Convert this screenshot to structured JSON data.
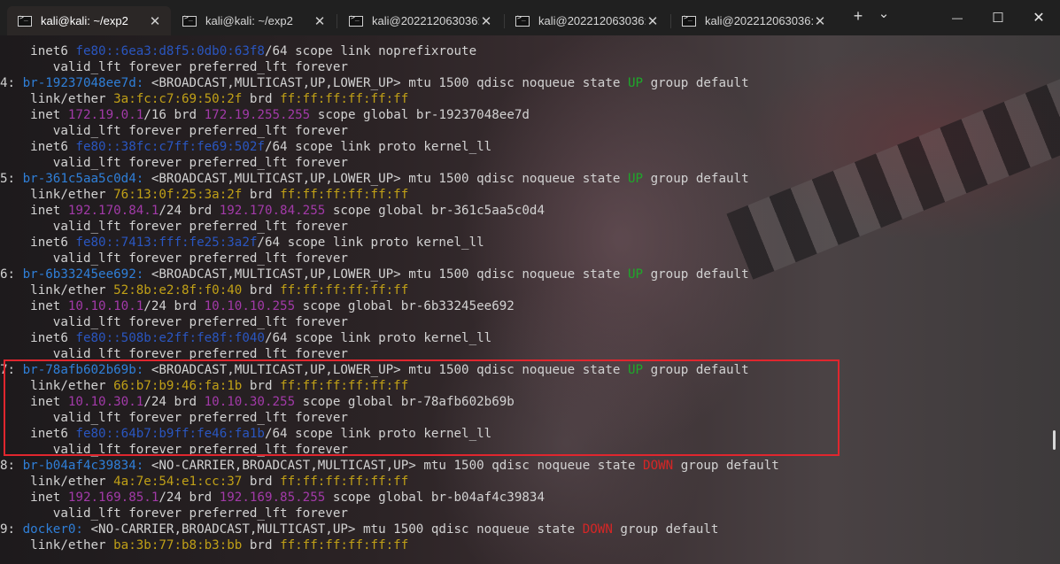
{
  "tabs": [
    {
      "title": "kali@kali: ~/exp2",
      "active": true,
      "icon": "terminal-icon",
      "close": "✕"
    },
    {
      "title": "kali@kali: ~/exp2",
      "active": false,
      "icon": "terminal-icon",
      "close": "✕"
    },
    {
      "title": "kali@202212063036:",
      "active": false,
      "icon": "terminal-icon",
      "close": "✕"
    },
    {
      "title": "kali@202212063036:",
      "active": false,
      "icon": "terminal-icon",
      "close": "✕"
    },
    {
      "title": "kali@202212063036:",
      "active": false,
      "icon": "cmd-icon",
      "close": "✕"
    }
  ],
  "toolbar": {
    "new_tab": "+",
    "dropdown": "⌄"
  },
  "window_controls": {
    "minimize": "—",
    "maximize": "☐",
    "close": "✕"
  },
  "colors": {
    "interface_name": "#2f7fd8",
    "ipv6": "#2a56c0",
    "ipv4": "#a23aa8",
    "mac": "#c0a017",
    "state_up": "#1ea82a",
    "state_down": "#d62626",
    "highlight_box": "#e0262e"
  },
  "terminal_lines": [
    [
      {
        "t": "    inet6 ",
        "c": "w"
      },
      {
        "t": "fe80::6ea3:d8f5:0db0:63f8",
        "c": "ipv6"
      },
      {
        "t": "/64 scope link noprefixroute",
        "c": "w"
      }
    ],
    [
      {
        "t": "       valid_lft forever preferred_lft forever",
        "c": "w"
      }
    ],
    [
      {
        "t": "4: ",
        "c": "w"
      },
      {
        "t": "br-19237048ee7d:",
        "c": "blue"
      },
      {
        "t": " <BROADCAST,MULTICAST,UP,LOWER_UP> mtu 1500 qdisc noqueue state ",
        "c": "w"
      },
      {
        "t": "UP",
        "c": "grn"
      },
      {
        "t": " group default",
        "c": "w"
      }
    ],
    [
      {
        "t": "    link/ether ",
        "c": "w"
      },
      {
        "t": "3a:fc:c7:69:50:2f",
        "c": "yel"
      },
      {
        "t": " brd ",
        "c": "w"
      },
      {
        "t": "ff:ff:ff:ff:ff:ff",
        "c": "yel"
      }
    ],
    [
      {
        "t": "    inet ",
        "c": "w"
      },
      {
        "t": "172.19.0.1",
        "c": "mag"
      },
      {
        "t": "/16 brd ",
        "c": "w"
      },
      {
        "t": "172.19.255.255",
        "c": "mag"
      },
      {
        "t": " scope global br-19237048ee7d",
        "c": "w"
      }
    ],
    [
      {
        "t": "       valid_lft forever preferred_lft forever",
        "c": "w"
      }
    ],
    [
      {
        "t": "    inet6 ",
        "c": "w"
      },
      {
        "t": "fe80::38fc:c7ff:fe69:502f",
        "c": "ipv6"
      },
      {
        "t": "/64 scope link proto kernel_ll",
        "c": "w"
      }
    ],
    [
      {
        "t": "       valid_lft forever preferred_lft forever",
        "c": "w"
      }
    ],
    [
      {
        "t": "5: ",
        "c": "w"
      },
      {
        "t": "br-361c5aa5c0d4:",
        "c": "blue"
      },
      {
        "t": " <BROADCAST,MULTICAST,UP,LOWER_UP> mtu 1500 qdisc noqueue state ",
        "c": "w"
      },
      {
        "t": "UP",
        "c": "grn"
      },
      {
        "t": " group default",
        "c": "w"
      }
    ],
    [
      {
        "t": "    link/ether ",
        "c": "w"
      },
      {
        "t": "76:13:0f:25:3a:2f",
        "c": "yel"
      },
      {
        "t": " brd ",
        "c": "w"
      },
      {
        "t": "ff:ff:ff:ff:ff:ff",
        "c": "yel"
      }
    ],
    [
      {
        "t": "    inet ",
        "c": "w"
      },
      {
        "t": "192.170.84.1",
        "c": "mag"
      },
      {
        "t": "/24 brd ",
        "c": "w"
      },
      {
        "t": "192.170.84.255",
        "c": "mag"
      },
      {
        "t": " scope global br-361c5aa5c0d4",
        "c": "w"
      }
    ],
    [
      {
        "t": "       valid_lft forever preferred_lft forever",
        "c": "w"
      }
    ],
    [
      {
        "t": "    inet6 ",
        "c": "w"
      },
      {
        "t": "fe80::7413:fff:fe25:3a2f",
        "c": "ipv6"
      },
      {
        "t": "/64 scope link proto kernel_ll",
        "c": "w"
      }
    ],
    [
      {
        "t": "       valid_lft forever preferred_lft forever",
        "c": "w"
      }
    ],
    [
      {
        "t": "6: ",
        "c": "w"
      },
      {
        "t": "br-6b33245ee692:",
        "c": "blue"
      },
      {
        "t": " <BROADCAST,MULTICAST,UP,LOWER_UP> mtu 1500 qdisc noqueue state ",
        "c": "w"
      },
      {
        "t": "UP",
        "c": "grn"
      },
      {
        "t": " group default",
        "c": "w"
      }
    ],
    [
      {
        "t": "    link/ether ",
        "c": "w"
      },
      {
        "t": "52:8b:e2:8f:f0:40",
        "c": "yel"
      },
      {
        "t": " brd ",
        "c": "w"
      },
      {
        "t": "ff:ff:ff:ff:ff:ff",
        "c": "yel"
      }
    ],
    [
      {
        "t": "    inet ",
        "c": "w"
      },
      {
        "t": "10.10.10.1",
        "c": "mag"
      },
      {
        "t": "/24 brd ",
        "c": "w"
      },
      {
        "t": "10.10.10.255",
        "c": "mag"
      },
      {
        "t": " scope global br-6b33245ee692",
        "c": "w"
      }
    ],
    [
      {
        "t": "       valid_lft forever preferred_lft forever",
        "c": "w"
      }
    ],
    [
      {
        "t": "    inet6 ",
        "c": "w"
      },
      {
        "t": "fe80::508b:e2ff:fe8f:f040",
        "c": "ipv6"
      },
      {
        "t": "/64 scope link proto kernel_ll",
        "c": "w"
      }
    ],
    [
      {
        "t": "       valid_lft forever preferred_lft forever",
        "c": "w"
      }
    ],
    [
      {
        "t": "7: ",
        "c": "w"
      },
      {
        "t": "br-78afb602b69b:",
        "c": "blue"
      },
      {
        "t": " <BROADCAST,MULTICAST,UP,LOWER_UP> mtu 1500 qdisc noqueue state ",
        "c": "w"
      },
      {
        "t": "UP",
        "c": "grn"
      },
      {
        "t": " group default",
        "c": "w"
      }
    ],
    [
      {
        "t": "    link/ether ",
        "c": "w"
      },
      {
        "t": "66:b7:b9:46:fa:1b",
        "c": "yel"
      },
      {
        "t": " brd ",
        "c": "w"
      },
      {
        "t": "ff:ff:ff:ff:ff:ff",
        "c": "yel"
      }
    ],
    [
      {
        "t": "    inet ",
        "c": "w"
      },
      {
        "t": "10.10.30.1",
        "c": "mag"
      },
      {
        "t": "/24 brd ",
        "c": "w"
      },
      {
        "t": "10.10.30.255",
        "c": "mag"
      },
      {
        "t": " scope global br-78afb602b69b",
        "c": "w"
      }
    ],
    [
      {
        "t": "       valid_lft forever preferred_lft forever",
        "c": "w"
      }
    ],
    [
      {
        "t": "    inet6 ",
        "c": "w"
      },
      {
        "t": "fe80::64b7:b9ff:fe46:fa1b",
        "c": "ipv6"
      },
      {
        "t": "/64 scope link proto kernel_ll",
        "c": "w"
      }
    ],
    [
      {
        "t": "       valid_lft forever preferred_lft forever",
        "c": "w"
      }
    ],
    [
      {
        "t": "8: ",
        "c": "w"
      },
      {
        "t": "br-b04af4c39834:",
        "c": "blue"
      },
      {
        "t": " <NO-CARRIER,BROADCAST,MULTICAST,UP> mtu 1500 qdisc noqueue state ",
        "c": "w"
      },
      {
        "t": "DOWN",
        "c": "red"
      },
      {
        "t": " group default",
        "c": "w"
      }
    ],
    [
      {
        "t": "    link/ether ",
        "c": "w"
      },
      {
        "t": "4a:7e:54:e1:cc:37",
        "c": "yel"
      },
      {
        "t": " brd ",
        "c": "w"
      },
      {
        "t": "ff:ff:ff:ff:ff:ff",
        "c": "yel"
      }
    ],
    [
      {
        "t": "    inet ",
        "c": "w"
      },
      {
        "t": "192.169.85.1",
        "c": "mag"
      },
      {
        "t": "/24 brd ",
        "c": "w"
      },
      {
        "t": "192.169.85.255",
        "c": "mag"
      },
      {
        "t": " scope global br-b04af4c39834",
        "c": "w"
      }
    ],
    [
      {
        "t": "       valid_lft forever preferred_lft forever",
        "c": "w"
      }
    ],
    [
      {
        "t": "9: ",
        "c": "w"
      },
      {
        "t": "docker0:",
        "c": "blue"
      },
      {
        "t": " <NO-CARRIER,BROADCAST,MULTICAST,UP> mtu 1500 qdisc noqueue state ",
        "c": "w"
      },
      {
        "t": "DOWN",
        "c": "red"
      },
      {
        "t": " group default",
        "c": "w"
      }
    ],
    [
      {
        "t": "    link/ether ",
        "c": "w"
      },
      {
        "t": "ba:3b:77:b8:b3:bb",
        "c": "yel"
      },
      {
        "t": " brd ",
        "c": "w"
      },
      {
        "t": "ff:ff:ff:ff:ff:ff",
        "c": "yel"
      }
    ]
  ]
}
